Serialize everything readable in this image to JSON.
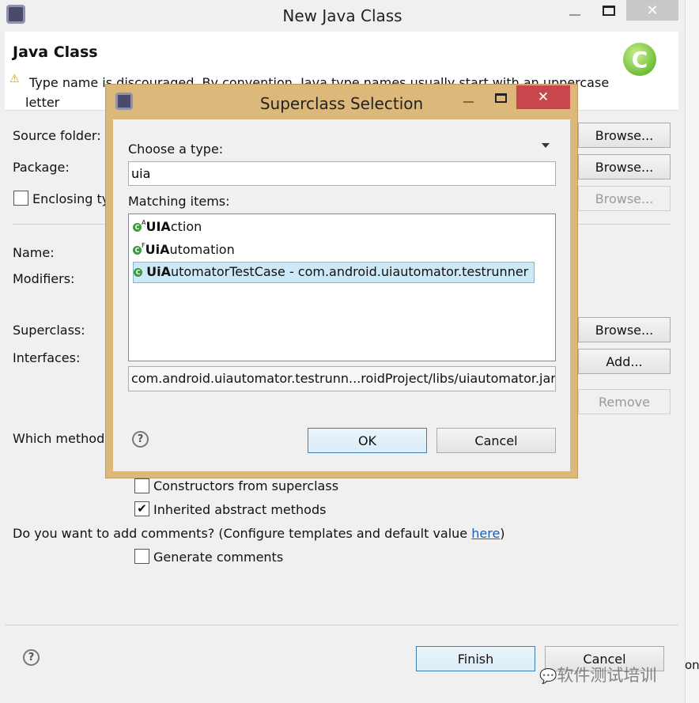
{
  "main": {
    "title": "New Java Class",
    "header_title": "Java Class",
    "warning_line1": "Type name is discouraged. By convention, Java type names usually start with an uppercase",
    "warning_line2": "letter",
    "source_folder_label": "Source folder:",
    "package_label": "Package:",
    "enclosing_label": "Enclosing type:",
    "name_label": "Name:",
    "modifiers_label": "Modifiers:",
    "superclass_label": "Superclass:",
    "interfaces_label": "Interfaces:",
    "which_methods_label": "Which method stubs would you like to create?",
    "browse": "Browse...",
    "add": "Add...",
    "remove": "Remove",
    "constructors": "Constructors from superclass",
    "inherited": "Inherited abstract methods",
    "comments_q": "Do you want to add comments? (Configure templates and default value ",
    "here_link": "here",
    "comments_q_end": ")",
    "generate_comments": "Generate comments",
    "finish": "Finish",
    "cancel": "Cancel",
    "help": "?",
    "right_edge_text": "on"
  },
  "dialog": {
    "title": "Superclass Selection",
    "choose_label": "Choose a type:",
    "search_value": "uia",
    "matching_label": "Matching items:",
    "items": [
      {
        "bold": "UIA",
        "rest": "ction",
        "badge": "A",
        "selected": false
      },
      {
        "bold": "UiA",
        "rest": "utomation",
        "badge": "F",
        "selected": false
      },
      {
        "bold": "UiA",
        "rest": "utomatorTestCase - com.android.uiautomator.testrunner",
        "badge": "",
        "selected": true
      }
    ],
    "status": "com.android.uiautomator.testrunn...roidProject/libs/uiautomator.jar",
    "ok": "OK",
    "cancel": "Cancel",
    "help": "?"
  },
  "watermark": "软件测试培训",
  "colors": {
    "dialog_border": "#dcb97a",
    "close_red": "#c7474c",
    "selection": "#cde8f7"
  }
}
